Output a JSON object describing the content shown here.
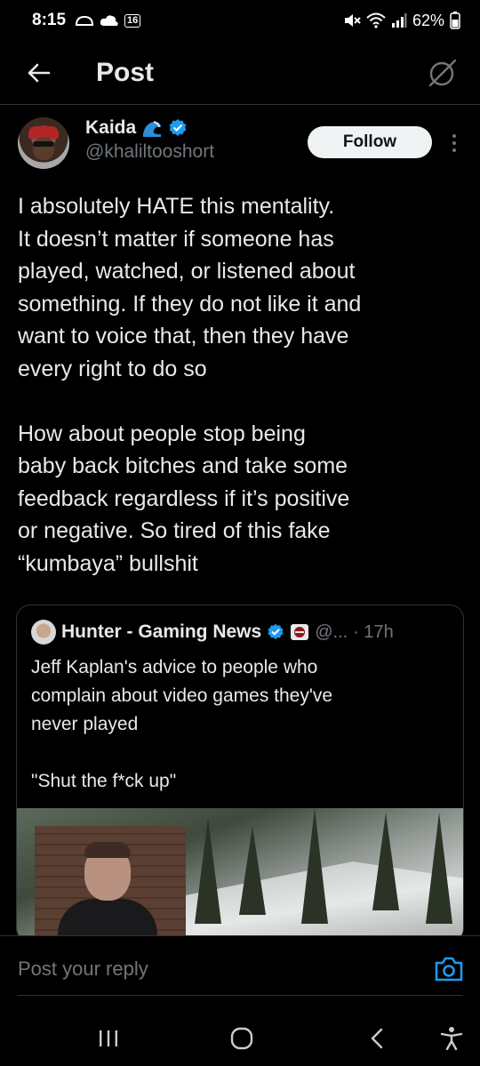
{
  "status_bar": {
    "time": "8:15",
    "badge": "16",
    "battery": "62%"
  },
  "header": {
    "title": "Post",
    "back_icon": "arrow-left-icon",
    "grok_icon": "grok-icon"
  },
  "post": {
    "author_name": "Kaida",
    "author_handle": "@khaliltooshort",
    "follow_label": "Follow",
    "paragraph1": [
      "I absolutely HATE this mentality.",
      "It doesn’t matter if someone has",
      "played, watched, or listened about",
      "something. If they do not like it and",
      "want to voice that, then they have",
      "every right to do so"
    ],
    "paragraph2": [
      "How about people stop being",
      "baby back bitches and take some",
      "feedback regardless if it’s positive",
      "or negative. So tired of this fake",
      "“kumbaya” bullshit"
    ]
  },
  "quote": {
    "author_name": "Hunter - Gaming News",
    "handle": "@...",
    "time": "· 17h",
    "text1": [
      "Jeff Kaplan's advice to people who",
      "complain about video games they've",
      "never played"
    ],
    "text2": "\"Shut the f*ck up\""
  },
  "reply": {
    "placeholder": "Post your reply",
    "camera_icon": "camera-icon"
  },
  "nav": {
    "recents_icon": "recents-icon",
    "home_icon": "home-icon",
    "back_icon": "back-icon",
    "accessibility_icon": "accessibility-icon"
  },
  "colors": {
    "background": "#000000",
    "text": "#e7e9ea",
    "muted": "#71767b",
    "verified": "#1d9bf0",
    "border": "#2f3336"
  }
}
